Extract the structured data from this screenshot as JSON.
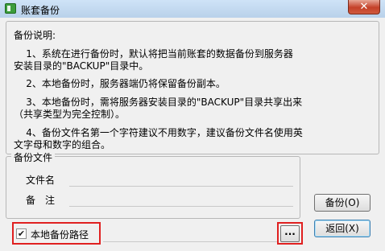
{
  "window": {
    "title": "账套备份",
    "close_label": "✕"
  },
  "description": {
    "heading": "备份说明:",
    "para1_line1": "    1、系统在进行备份时，默认将把当前账套的数据备份到服务器",
    "para1_line2": "安装目录的\"BACKUP\"目录中。",
    "para2_line1": "    2、本地备份时，服务器端仍将保留备份副本。",
    "para3_line1": "    3、本地备份时，需将服务器安装目录的\"BACKUP\"目录共享出来",
    "para3_line2": "（共享类型为完全控制）。",
    "para4_line1": "    4、备份文件名第一个字符建议不用数字，建议备份文件名使用英",
    "para4_line2": "文字母和数字的组合。"
  },
  "backup_file": {
    "legend": "备份文件",
    "filename_label": "文件名",
    "remark_label": "备　注",
    "filename_value": "",
    "remark_value": ""
  },
  "buttons": {
    "backup": "备份(O)",
    "back": "返回(X)",
    "browse": "..."
  },
  "local_backup": {
    "label": "本地备份路径",
    "checked": true,
    "check_mark": "✔",
    "path_value": ""
  }
}
